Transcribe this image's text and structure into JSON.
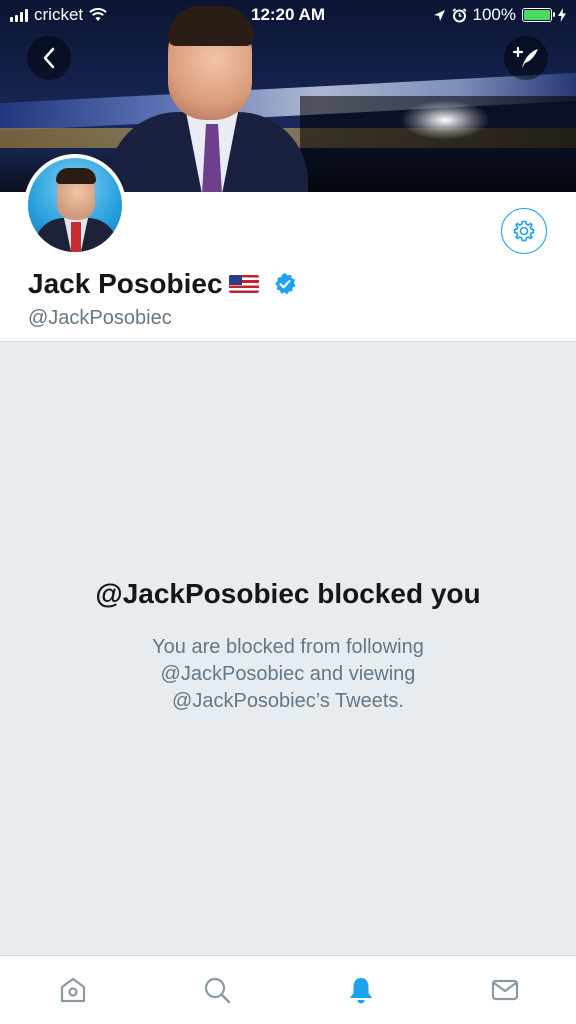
{
  "status_bar": {
    "carrier": "cricket",
    "time": "12:20 AM",
    "battery_percent": "100%",
    "battery_level": 1.0,
    "icons": [
      "signal-icon",
      "wifi-icon",
      "location-icon",
      "alarm-icon",
      "battery-icon",
      "charging-icon"
    ]
  },
  "header": {
    "back_icon": "back-arrow-icon",
    "compose_icon": "compose-tweet-icon"
  },
  "profile": {
    "name": "Jack Posobiec",
    "name_emoji": "us-flag",
    "verified": true,
    "handle": "@JackPosobiec",
    "settings_icon": "gear-icon"
  },
  "blocked": {
    "title": "@JackPosobiec blocked you",
    "line1": "You are blocked from following",
    "line2": "@JackPosobiec and viewing",
    "line3": "@JackPosobiec’s Tweets."
  },
  "tabbar": {
    "tabs": [
      {
        "name": "home",
        "icon": "home-icon",
        "active": false
      },
      {
        "name": "search",
        "icon": "search-icon",
        "active": false
      },
      {
        "name": "notifications",
        "icon": "bell-icon",
        "active": true
      },
      {
        "name": "messages",
        "icon": "envelope-icon",
        "active": false
      }
    ]
  },
  "colors": {
    "accent": "#1da1f2",
    "text_primary": "#14171a",
    "text_secondary": "#657786",
    "background": "#e6ecf0",
    "battery": "#4cd964"
  }
}
